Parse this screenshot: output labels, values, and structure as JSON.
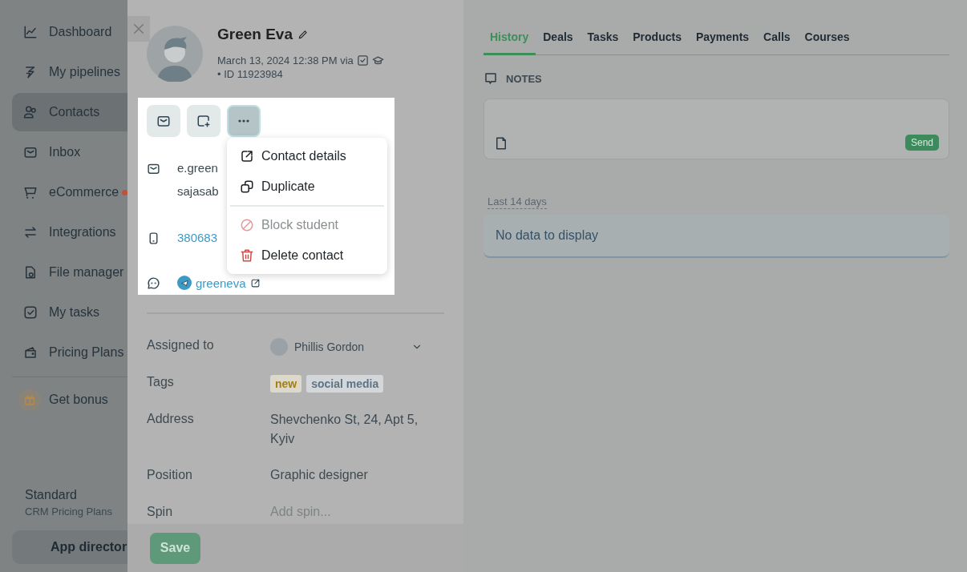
{
  "sidebar": {
    "items": [
      {
        "label": "Dashboard",
        "kind": "chart",
        "selected": false,
        "notification": false
      },
      {
        "label": "My pipelines",
        "kind": "pipeline",
        "selected": false,
        "notification": false
      },
      {
        "label": "Contacts",
        "kind": "people",
        "selected": true,
        "notification": false
      },
      {
        "label": "Inbox",
        "kind": "mail",
        "selected": false,
        "notification": false
      },
      {
        "label": "eCommerce",
        "kind": "cart",
        "selected": false,
        "notification": true
      },
      {
        "label": "Integrations",
        "kind": "arrows",
        "selected": false,
        "notification": false
      },
      {
        "label": "File manager",
        "kind": "file",
        "selected": false,
        "notification": false
      },
      {
        "label": "My tasks",
        "kind": "check",
        "selected": false,
        "notification": false
      },
      {
        "label": "Pricing Plans",
        "kind": "wallet",
        "selected": false,
        "notification": false
      }
    ],
    "bonus": "Get bonus",
    "plan": {
      "name": "Standard",
      "subtitle": "CRM Pricing Plans"
    },
    "app_button": "App director"
  },
  "contact": {
    "name": "Green Eva",
    "created": "March 13, 2024 12:38 PM via",
    "id": "• ID 11923984",
    "actions": [
      {
        "kind": "mail",
        "selected": false
      },
      {
        "kind": "add",
        "selected": false
      },
      {
        "kind": "more",
        "selected": true
      }
    ],
    "menu": [
      [
        {
          "label": "Contact details",
          "kind": "open",
          "disabled": false
        },
        {
          "label": "Duplicate",
          "kind": "duplicate",
          "disabled": false
        }
      ],
      [
        {
          "label": "Block student",
          "kind": "block",
          "disabled": true
        },
        {
          "label": "Delete contact",
          "kind": "delete",
          "disabled": false
        }
      ]
    ],
    "channels": [
      {
        "kind": "email",
        "values": [
          "e.green",
          "sajasab"
        ]
      },
      {
        "kind": "phone",
        "values": [
          "380683"
        ]
      },
      {
        "kind": "telegram",
        "values": [
          "greeneva"
        ]
      }
    ],
    "fields": [
      {
        "label": "Assigned to",
        "kind": "user",
        "value": "Phillis Gordon"
      },
      {
        "label": "Tags",
        "kind": "tags",
        "tags": [
          {
            "text": "new",
            "color": "#a57f0c"
          },
          {
            "text": "social media",
            "color": "#5e7485"
          }
        ]
      },
      {
        "label": "Address",
        "kind": "text",
        "value": "Shevchenko St, 24, Apt 5, Kyiv"
      },
      {
        "label": "Position",
        "kind": "text",
        "value": "Graphic designer"
      },
      {
        "label": "Spin",
        "kind": "input",
        "placeholder": "Add spin..."
      }
    ],
    "save": "Save"
  },
  "tabs": [
    {
      "label": "History",
      "selected": true
    },
    {
      "label": "Deals",
      "selected": false
    },
    {
      "label": "Tasks",
      "selected": false
    },
    {
      "label": "Products",
      "selected": false
    },
    {
      "label": "Payments",
      "selected": false
    },
    {
      "label": "Calls",
      "selected": false
    },
    {
      "label": "Courses",
      "selected": false
    }
  ],
  "notes": {
    "title": "NOTES",
    "send": "Send"
  },
  "history": {
    "period": "Last 14 days",
    "empty": "No data to display"
  }
}
